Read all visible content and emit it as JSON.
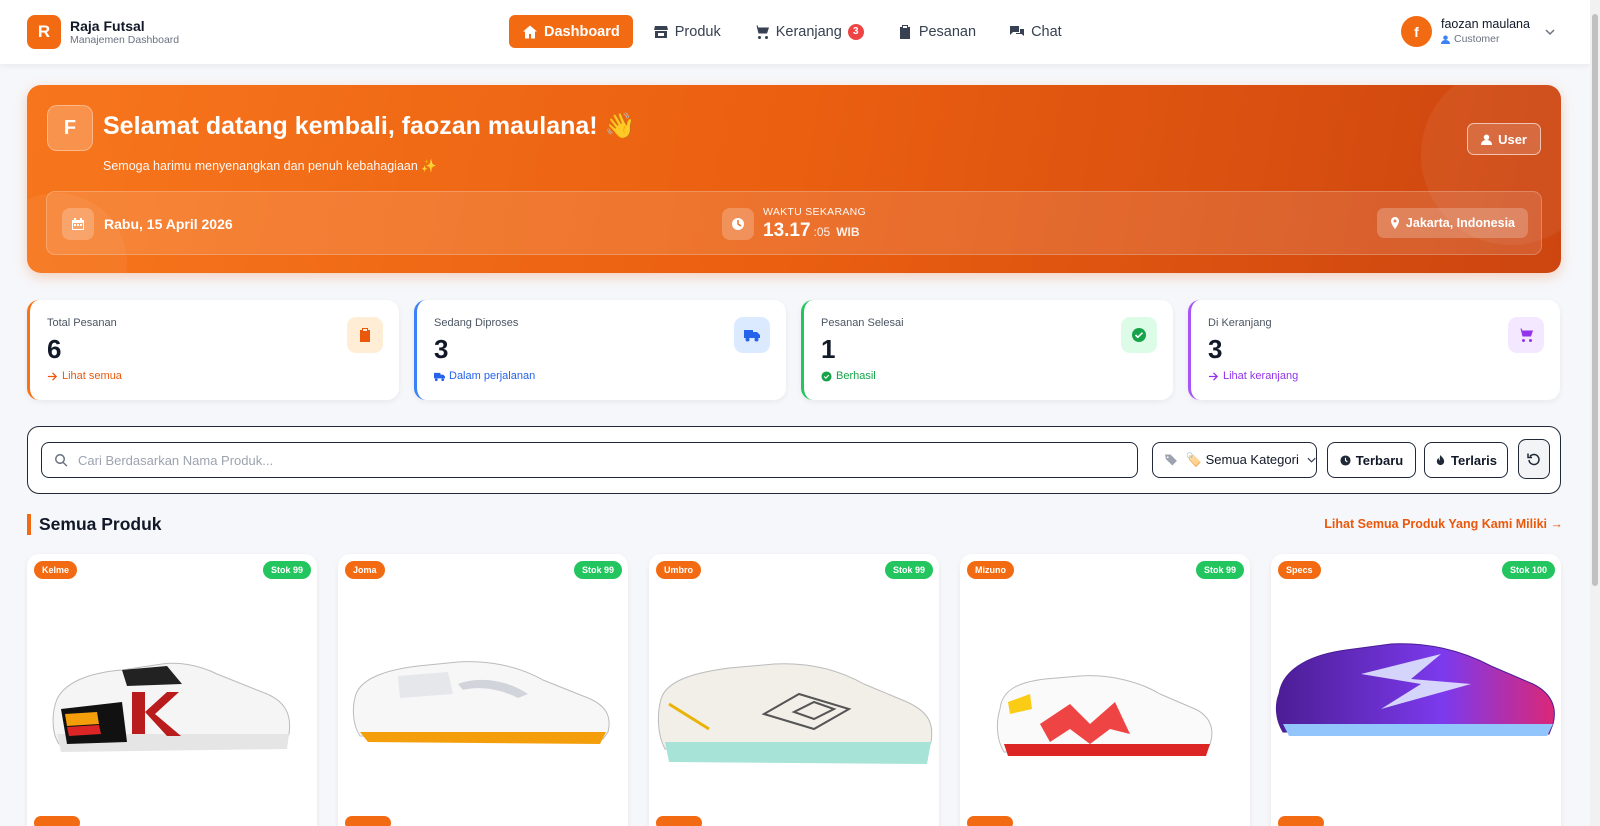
{
  "brand": {
    "logo_letter": "R",
    "name": "Raja Futsal",
    "subtitle": "Manajemen Dashboard"
  },
  "nav": [
    {
      "label": "Dashboard",
      "icon": "home-icon",
      "active": true
    },
    {
      "label": "Produk",
      "icon": "store-icon"
    },
    {
      "label": "Keranjang",
      "icon": "cart-icon",
      "badge": "3"
    },
    {
      "label": "Pesanan",
      "icon": "clipboard-icon"
    },
    {
      "label": "Chat",
      "icon": "chat-icon"
    }
  ],
  "user": {
    "initial": "f",
    "name": "faozan maulana",
    "role": "Customer"
  },
  "hero": {
    "initial": "F",
    "title": "Selamat datang kembali, faozan maulana! 👋",
    "subtitle": "Semoga harimu menyenangkan dan penuh kebahagiaan ✨",
    "role_button": "User",
    "date": "Rabu, 15 April 2026",
    "time_label": "WAKTU SEKARANG",
    "time_main": "13.17",
    "time_seconds": ":05",
    "timezone": "WIB",
    "location": "Jakarta, Indonesia"
  },
  "stats": [
    {
      "label": "Total Pesanan",
      "value": "6",
      "link": "Lihat semua",
      "color": "#f97316"
    },
    {
      "label": "Sedang Diproses",
      "value": "3",
      "link": "Dalam perjalanan",
      "color": "#3b82f6"
    },
    {
      "label": "Pesanan Selesai",
      "value": "1",
      "link": "Berhasil",
      "color": "#22c55e"
    },
    {
      "label": "Di Keranjang",
      "value": "3",
      "link": "Lihat keranjang",
      "color": "#a855f7"
    }
  ],
  "filters": {
    "search_placeholder": "Cari Berdasarkan Nama Produk...",
    "category": "🏷️ Semua Kategori",
    "newest": "Terbaru",
    "bestseller": "Terlaris"
  },
  "section": {
    "title": "Semua Produk",
    "link": "Lihat Semua Produk Yang Kami Miliki →"
  },
  "products": [
    {
      "brand": "Kelme",
      "stock": "Stok 99"
    },
    {
      "brand": "Joma",
      "stock": "Stok 99"
    },
    {
      "brand": "Umbro",
      "stock": "Stok 99"
    },
    {
      "brand": "Mizuno",
      "stock": "Stok 99"
    },
    {
      "brand": "Specs",
      "stock": "Stok 100"
    }
  ],
  "colors": {
    "accent": "#f26b12",
    "success": "#22c55e",
    "danger": "#ef4444"
  }
}
